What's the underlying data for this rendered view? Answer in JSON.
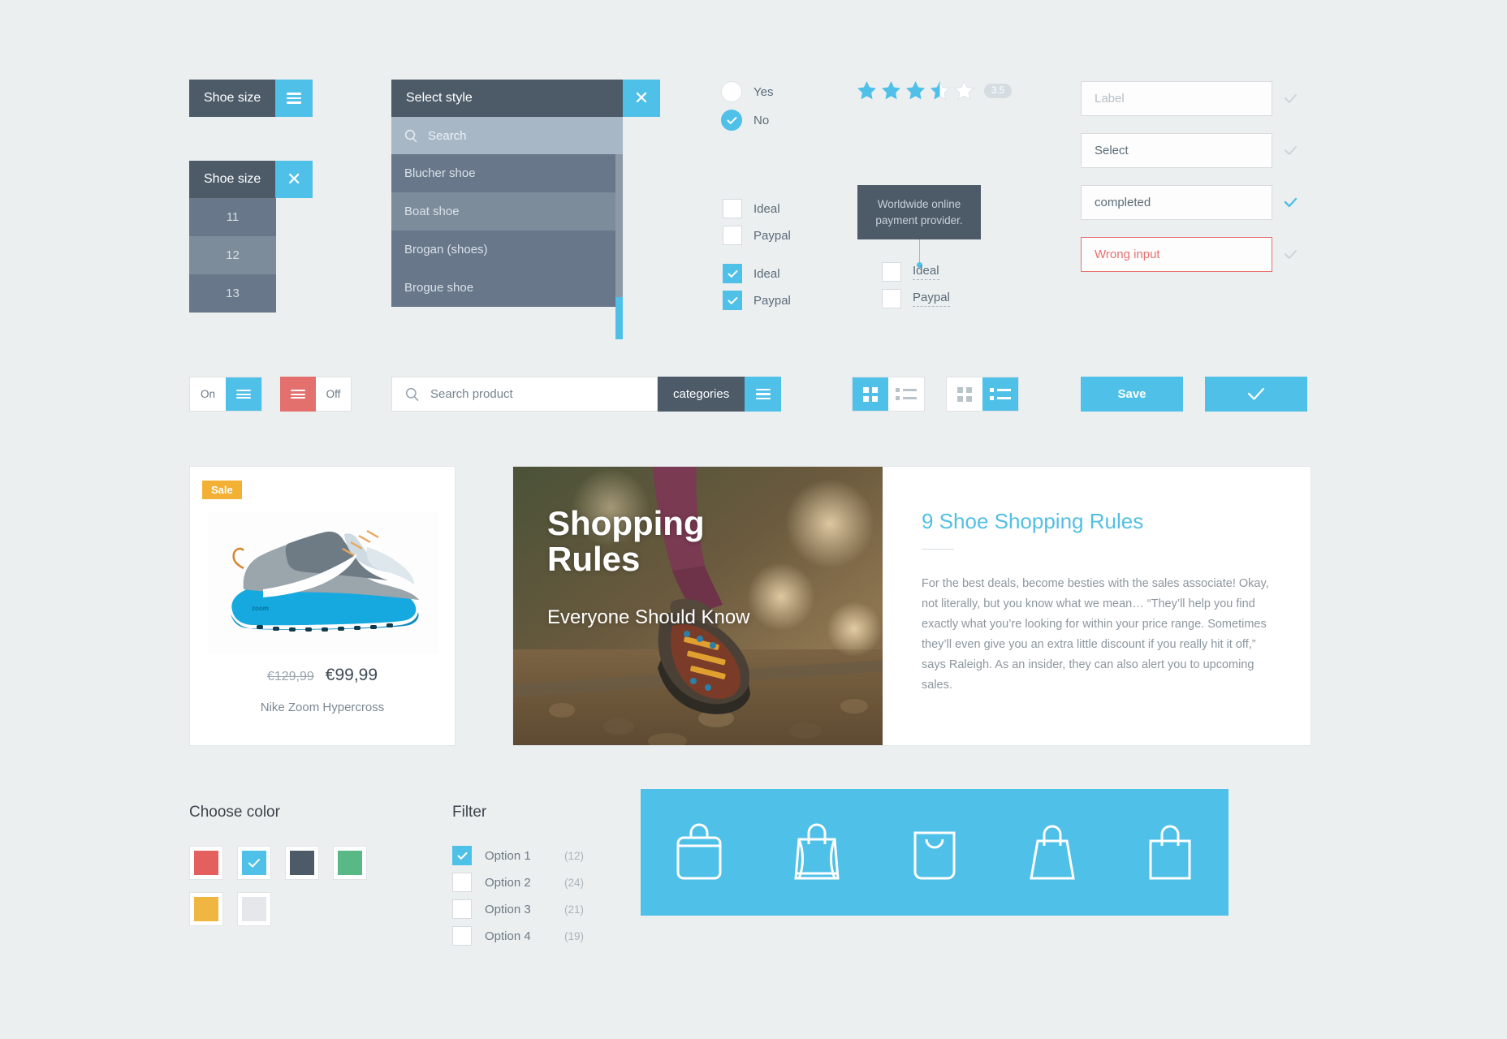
{
  "theme": {
    "accent": "#4fc0e8",
    "slate": "#4d5b69",
    "background": "#eceff0",
    "error": "#e8716f",
    "sale": "#f2b134"
  },
  "dropdown_menu": {
    "title": "Shoe size",
    "icon": "hamburger-icon"
  },
  "size_dropdown": {
    "title": "Shoe size",
    "close_icon": "close-icon",
    "sizes": [
      "11",
      "12",
      "13"
    ]
  },
  "style_select": {
    "title": "Select style",
    "close_icon": "close-icon",
    "search_placeholder": "Search",
    "search_icon": "search-icon",
    "options": [
      "Blucher shoe",
      "Boat shoe",
      "Brogan (shoes)",
      "Brogue shoe"
    ]
  },
  "radio_group": {
    "items": [
      {
        "label": "Yes",
        "checked": false
      },
      {
        "label": "No",
        "checked": true
      }
    ]
  },
  "checkbox_group_unchecked": {
    "items": [
      {
        "label": "Ideal",
        "checked": false
      },
      {
        "label": "Paypal",
        "checked": false
      }
    ]
  },
  "checkbox_group_checked": {
    "items": [
      {
        "label": "Ideal",
        "checked": true
      },
      {
        "label": "Paypal",
        "checked": true
      }
    ]
  },
  "tooltip": {
    "text": "Worldwide online payment provider."
  },
  "tooltip_checkboxes": {
    "items": [
      {
        "label": "Ideal",
        "checked": false
      },
      {
        "label": "Paypal",
        "checked": false
      }
    ]
  },
  "rating": {
    "value": "3.5",
    "max": 5,
    "full_stars": 3,
    "half_stars": 1,
    "empty_stars": 1
  },
  "form_fields": [
    {
      "value": "Label",
      "state": "placeholder",
      "check": "inactive"
    },
    {
      "value": "Select",
      "state": "filled",
      "check": "inactive"
    },
    {
      "value": "completed",
      "state": "filled",
      "check": "active"
    },
    {
      "value": "Wrong input",
      "state": "error",
      "check": "inactive"
    }
  ],
  "toggle_on": {
    "label": "On",
    "handle_icon": "hamburger-icon",
    "state": "on"
  },
  "toggle_off": {
    "label": "Off",
    "handle_icon": "hamburger-icon",
    "state": "off"
  },
  "search": {
    "placeholder": "Search product",
    "search_icon": "search-icon",
    "categories_label": "categories",
    "menu_icon": "hamburger-icon"
  },
  "view_toggle_grid": {
    "grid_icon": "grid-view-icon",
    "list_icon": "list-view-icon",
    "active": "grid"
  },
  "view_toggle_list": {
    "grid_icon": "grid-view-icon",
    "list_icon": "list-view-icon",
    "active": "list"
  },
  "buttons": {
    "save_label": "Save",
    "confirm_icon": "check-icon"
  },
  "product_card": {
    "badge": "Sale",
    "old_price": "€129,99",
    "new_price": "€99,99",
    "name": "Nike Zoom Hypercross"
  },
  "hero": {
    "heading_line1": "Shopping",
    "heading_line2": "Rules",
    "subheading": "Everyone Should Know"
  },
  "article": {
    "title": "9 Shoe Shopping Rules",
    "body": "For the best deals, become besties with the sales associate! Okay, not literally, but you know what we mean… “They’ll help you find exactly what you’re looking for within your price range. Sometimes they’ll even give you an extra little discount if you really hit it off,” says Raleigh. As an insider, they can also alert you to upcoming sales."
  },
  "choose_color": {
    "title": "Choose color",
    "swatches": [
      {
        "name": "red",
        "hex": "#e4605e",
        "selected": false
      },
      {
        "name": "blue",
        "hex": "#4fc0e8",
        "selected": true
      },
      {
        "name": "slate",
        "hex": "#4d5b69",
        "selected": false
      },
      {
        "name": "green",
        "hex": "#58b987",
        "selected": false
      },
      {
        "name": "yellow",
        "hex": "#efb741",
        "selected": false
      },
      {
        "name": "grey",
        "hex": "#e5e7ea",
        "selected": false
      }
    ]
  },
  "filter": {
    "title": "Filter",
    "options": [
      {
        "label": "Option 1",
        "count": "(12)",
        "checked": true
      },
      {
        "label": "Option 2",
        "count": "(24)",
        "checked": false
      },
      {
        "label": "Option 3",
        "count": "(21)",
        "checked": false
      },
      {
        "label": "Option 4",
        "count": "(19)",
        "checked": false
      }
    ]
  },
  "bag_icons": [
    "shopping-bag-rounded-icon",
    "shopping-bag-paper-icon",
    "shopping-bag-handle-cutout-icon",
    "shopping-bag-trapezoid-icon",
    "shopping-bag-square-icon"
  ]
}
